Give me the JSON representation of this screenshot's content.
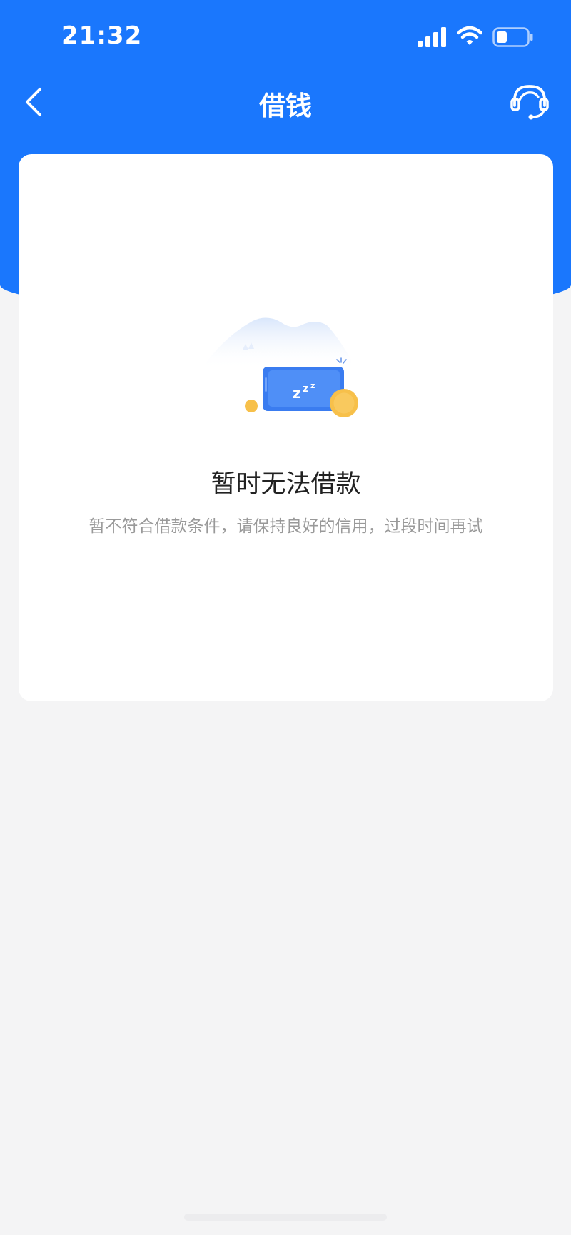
{
  "status_bar": {
    "time": "21:32"
  },
  "nav": {
    "title": "借钱",
    "back_icon": "chevron-left-icon",
    "service_icon": "customer-service-headset-icon"
  },
  "empty_state": {
    "illustration": "sleeping-phone-illustration",
    "title": "暂时无法借款",
    "description": "暂不符合借款条件，请保持良好的信用，过段时间再试"
  },
  "colors": {
    "header_bg": "#1a77fd",
    "page_bg": "#f4f4f5",
    "card_bg": "#ffffff",
    "title_text": "#222222",
    "desc_text": "#999999",
    "coin": "#f7c04a"
  }
}
